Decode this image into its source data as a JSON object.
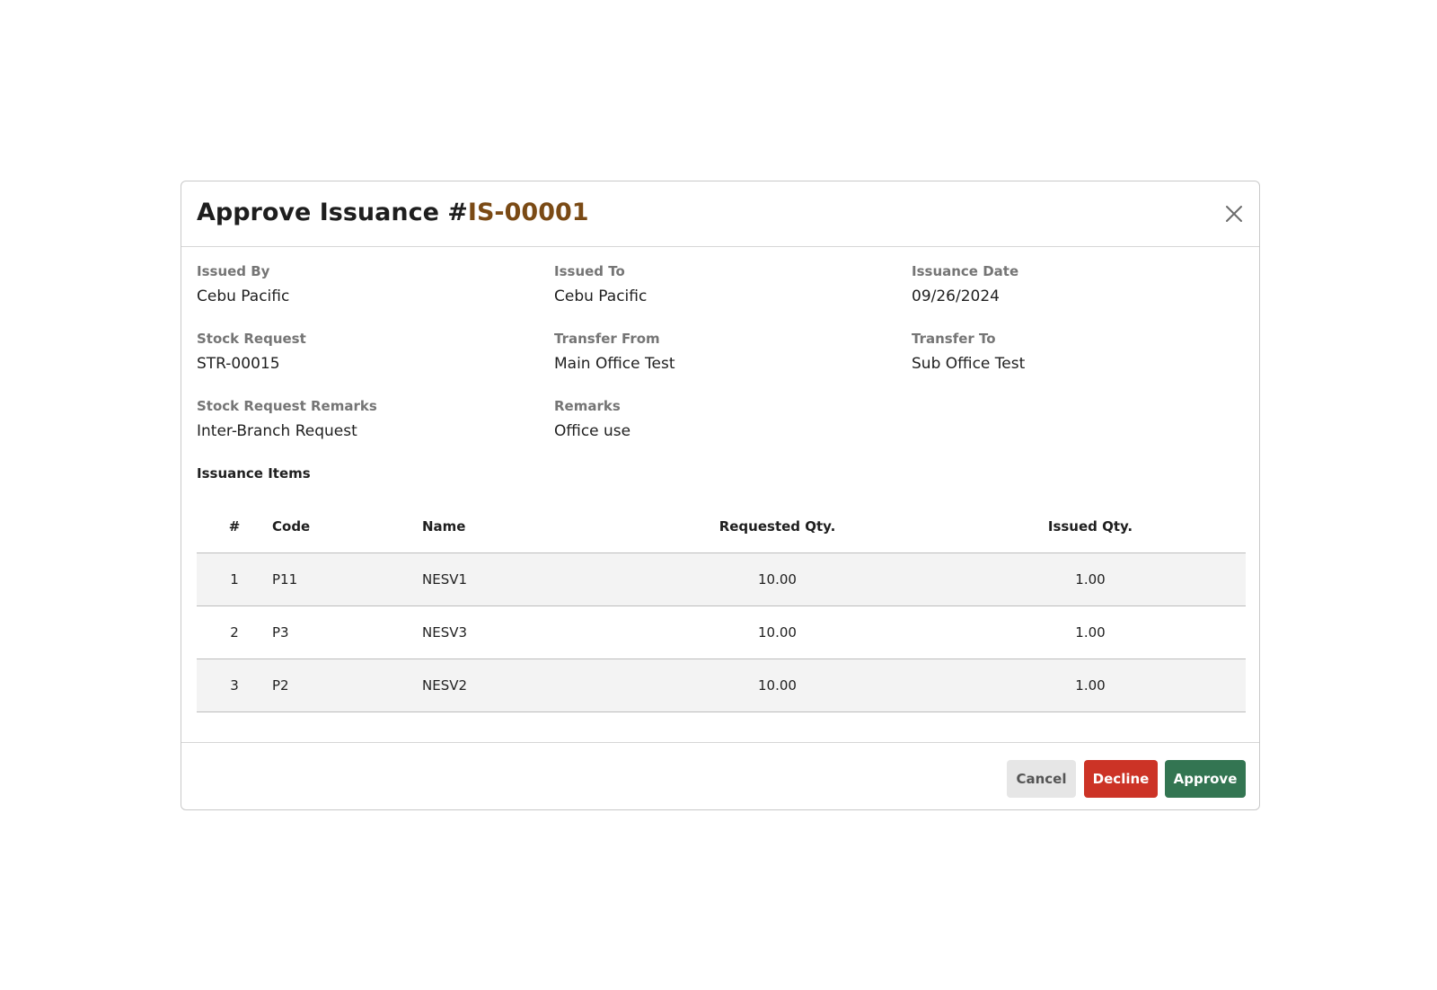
{
  "modal": {
    "title_prefix": "Approve Issuance #",
    "title_code": "IS-00001",
    "close_icon": "close-icon"
  },
  "details": {
    "issued_by": {
      "label": "Issued By",
      "value": "Cebu Pacific"
    },
    "issued_to": {
      "label": "Issued To",
      "value": "Cebu Pacific"
    },
    "issuance_date": {
      "label": "Issuance Date",
      "value": "09/26/2024"
    },
    "stock_request": {
      "label": "Stock Request",
      "value": "STR-00015"
    },
    "transfer_from": {
      "label": "Transfer From",
      "value": "Main Office Test"
    },
    "transfer_to": {
      "label": "Transfer To",
      "value": "Sub Office Test"
    },
    "stock_request_remarks": {
      "label": "Stock Request Remarks",
      "value": "Inter-Branch Request"
    },
    "remarks": {
      "label": "Remarks",
      "value": "Office use"
    }
  },
  "items": {
    "title": "Issuance Items",
    "columns": {
      "num": "#",
      "code": "Code",
      "name": "Name",
      "requested_qty": "Requested Qty.",
      "issued_qty": "Issued Qty."
    },
    "rows": [
      {
        "num": "1",
        "code": "P11",
        "name": "NESV1",
        "requested_qty": "10.00",
        "issued_qty": "1.00"
      },
      {
        "num": "2",
        "code": "P3",
        "name": "NESV3",
        "requested_qty": "10.00",
        "issued_qty": "1.00"
      },
      {
        "num": "3",
        "code": "P2",
        "name": "NESV2",
        "requested_qty": "10.00",
        "issued_qty": "1.00"
      }
    ]
  },
  "footer": {
    "cancel_label": "Cancel",
    "decline_label": "Decline",
    "approve_label": "Approve"
  },
  "colors": {
    "title_code": "#7a4a15",
    "decline": "#cc3326",
    "approve": "#337552",
    "cancel": "#e6e6e6",
    "row_stripe": "#f3f3f3"
  }
}
